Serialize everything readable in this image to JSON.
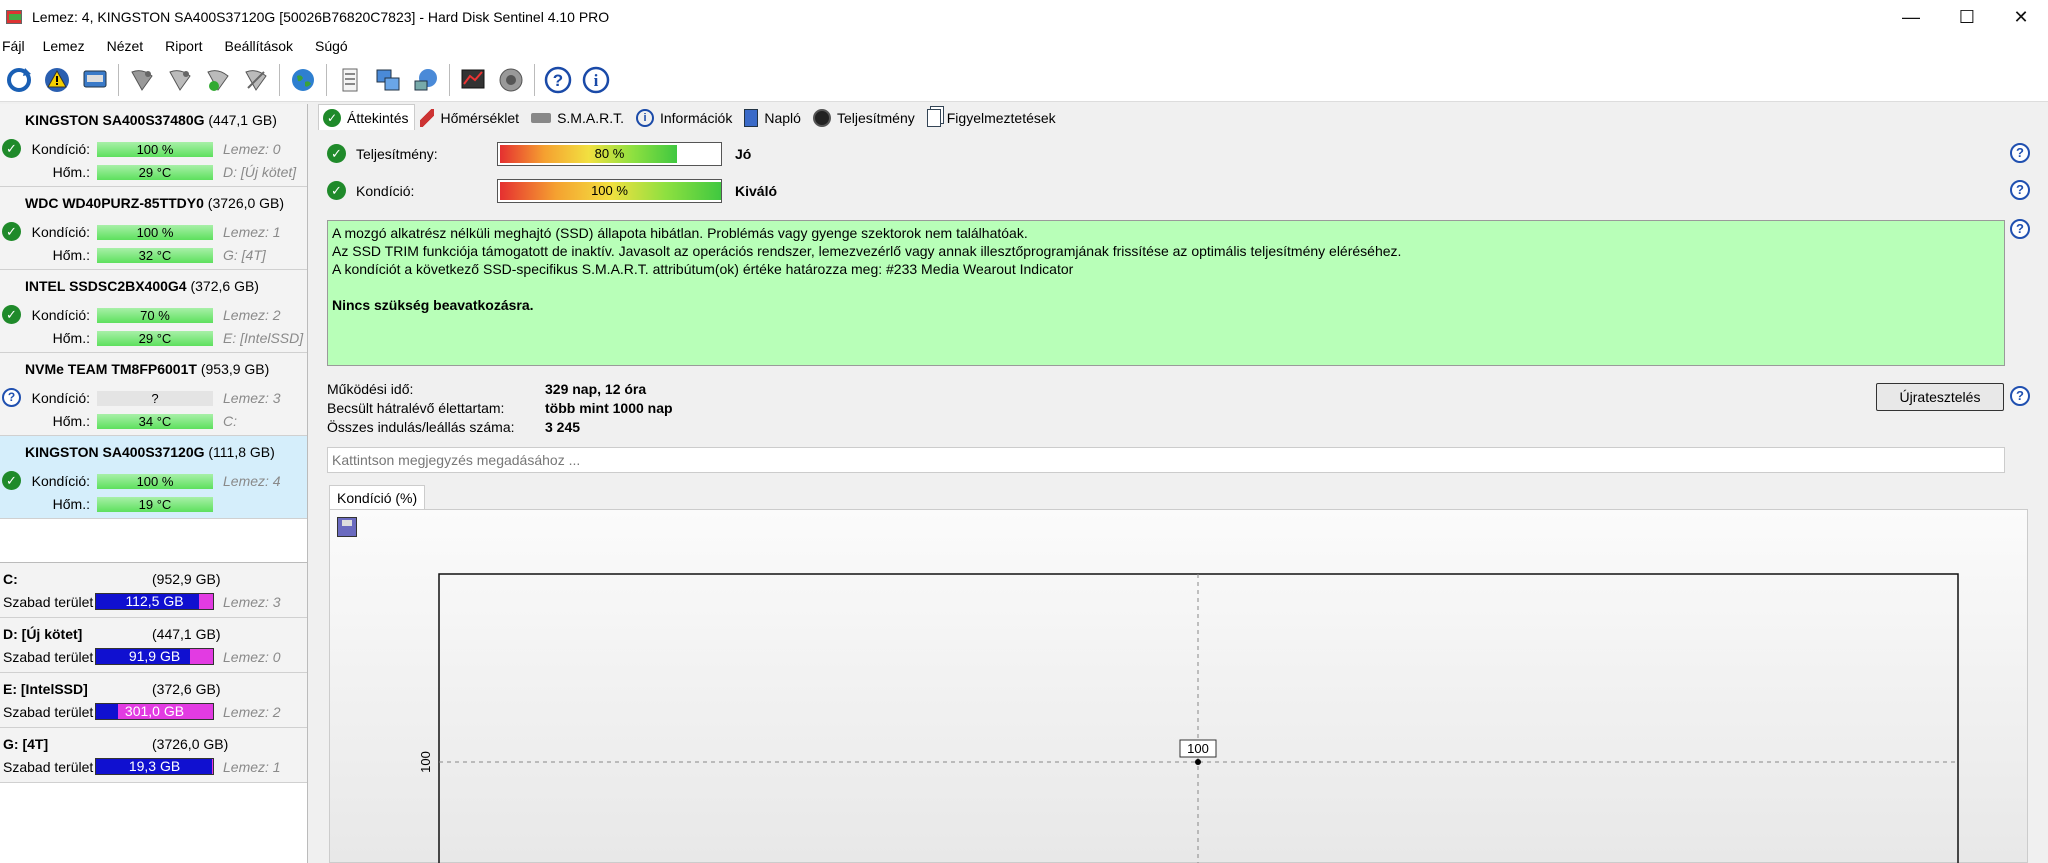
{
  "window": {
    "title": "Lemez: 4, KINGSTON SA400S37120G [50026B76820C7823]  -  Hard Disk Sentinel 4.10 PRO",
    "minimize": "—",
    "maximize": "☐",
    "close": "✕"
  },
  "menu": [
    "Fájl",
    "Lemez",
    "Nézet",
    "Riport",
    "Beállítások",
    "Súgó"
  ],
  "toolbar_icons": [
    "refresh-icon",
    "alert-icon",
    "disk-icon",
    "satellite-icon",
    "satellite-icon",
    "satellite-icon",
    "satellite-icon",
    "globe-icon",
    "report-icon",
    "network-icon",
    "network-icon",
    "chart-icon",
    "speaker-icon",
    "help-icon",
    "info-icon"
  ],
  "disks": [
    {
      "model": "KINGSTON SA400S37480G",
      "size": "(447,1 GB)",
      "cond_label": "Kondíció:",
      "cond": "100 %",
      "temp_label": "Hőm.:",
      "temp": "29 °C",
      "idx": "Lemez: 0",
      "vol": "D: [Új kötet]",
      "status": "ok",
      "cond_pct": 100
    },
    {
      "model": "WDC WD40PURZ-85TTDY0",
      "size": "(3726,0 GB)",
      "cond_label": "Kondíció:",
      "cond": "100 %",
      "temp_label": "Hőm.:",
      "temp": "32 °C",
      "idx": "Lemez: 1",
      "vol": "G: [4T]",
      "status": "ok",
      "cond_pct": 100
    },
    {
      "model": "INTEL SSDSC2BX400G4",
      "size": "(372,6 GB)",
      "cond_label": "Kondíció:",
      "cond": "70 %",
      "temp_label": "Hőm.:",
      "temp": "29 °C",
      "idx": "Lemez: 2",
      "vol": "E: [IntelSSD]",
      "status": "ok",
      "cond_pct": 70
    },
    {
      "model": "NVMe    TEAM TM8FP6001T",
      "size": "(953,9 GB)",
      "cond_label": "Kondíció:",
      "cond": "?",
      "temp_label": "Hőm.:",
      "temp": "34 °C",
      "idx": "Lemez: 3",
      "vol": "C:",
      "status": "unknown",
      "cond_pct": 0
    },
    {
      "model": "KINGSTON SA400S37120G",
      "size": "(111,8 GB)",
      "cond_label": "Kondíció:",
      "cond": "100 %",
      "temp_label": "Hőm.:",
      "temp": "19 °C",
      "idx": "Lemez: 4",
      "vol": "",
      "status": "ok",
      "cond_pct": 100
    }
  ],
  "volumes": [
    {
      "name": "C:",
      "size": "(952,9 GB)",
      "free_label": "Szabad terület",
      "free": "112,5 GB",
      "idx": "Lemez: 3",
      "free_pct": 88
    },
    {
      "name": "D: [Új kötet]",
      "size": "(447,1 GB)",
      "free_label": "Szabad terület",
      "free": "91,9 GB",
      "idx": "Lemez: 0",
      "free_pct": 80
    },
    {
      "name": "E: [IntelSSD]",
      "size": "(372,6 GB)",
      "free_label": "Szabad terület",
      "free": "301,0 GB",
      "idx": "Lemez: 2",
      "free_pct": 19
    },
    {
      "name": "G: [4T]",
      "size": "(3726,0 GB)",
      "free_label": "Szabad terület",
      "free": "19,3 GB",
      "idx": "Lemez: 1",
      "free_pct": 99
    }
  ],
  "tabs": [
    "Áttekintés",
    "Hőmérséklet",
    "S.M.A.R.T.",
    "Információk",
    "Napló",
    "Teljesítmény",
    "Figyelmeztetések"
  ],
  "overview": {
    "perf_label": "Teljesítmény:",
    "perf_value": "80 %",
    "perf_pct": 80,
    "perf_rating": "Jó",
    "cond_label": "Kondíció:",
    "cond_value": "100 %",
    "cond_pct": 100,
    "cond_rating": "Kiváló",
    "message_lines": [
      "A mozgó alkatrész nélküli meghajtó (SSD) állapota hibátlan. Problémás vagy gyenge szektorok nem találhatóak.",
      "Az SSD TRIM funkciója támogatott de inaktív. Javasolt az operációs rendszer, lemezvezérlő vagy annak illesztőprogramjának frissítése az optimális teljesítmény eléréséhez.",
      "A kondíciót a következő SSD-specifikus S.M.A.R.T. attribútum(ok) értéke határozza meg:  #233 Media Wearout Indicator"
    ],
    "message_bold": "Nincs szükség beavatkozásra.",
    "uptime_label": "Működési idő:",
    "uptime": "329 nap, 12 óra",
    "life_label": "Becsült hátralévő élettartam:",
    "life": "több mint 1000 nap",
    "starts_label": "Összes indulás/leállás száma:",
    "starts": "3 245",
    "retest": "Újratesztelés",
    "note_placeholder": "Kattintson megjegyzés megadásához ...",
    "help": "?"
  },
  "chart_data": {
    "type": "line",
    "tab_label": "Kondíció  (%)",
    "x": [
      0
    ],
    "values": [
      100
    ],
    "point_label": "100",
    "ylabel": "",
    "ytick": "100",
    "grid": true
  }
}
